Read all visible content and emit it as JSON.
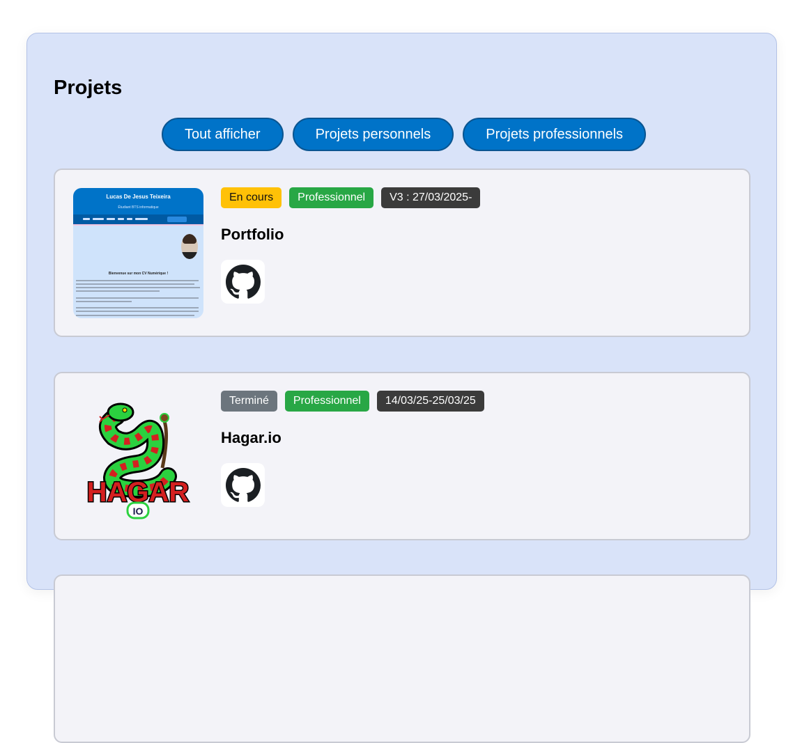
{
  "section": {
    "title": "Projets"
  },
  "filters": [
    {
      "label": "Tout afficher"
    },
    {
      "label": "Projets personnels"
    },
    {
      "label": "Projets professionnels"
    }
  ],
  "projects": [
    {
      "title": "Portfolio",
      "badges": [
        {
          "label": "En cours",
          "color": "#ffc107"
        },
        {
          "label": "Professionnel",
          "color": "#28a745"
        },
        {
          "label": "V3 : 27/03/2025-",
          "color": "#3b3b3b"
        }
      ],
      "thumbnail": {
        "name": "Lucas De Jesus Teixeira",
        "subtitle": "Étudiant BTS informatique",
        "welcome": "Bienvenue sur mon CV Numérique !"
      },
      "link_icon": "github-icon"
    },
    {
      "title": "Hagar.io",
      "badges": [
        {
          "label": "Terminé",
          "color": "#6c757d"
        },
        {
          "label": "Professionnel",
          "color": "#28a745"
        },
        {
          "label": "14/03/25-25/03/25",
          "color": "#3b3b3b"
        }
      ],
      "thumbnail": {
        "logo_text": "HAGAR",
        "logo_sub": "IO"
      },
      "link_icon": "github-icon"
    }
  ],
  "colors": {
    "accent": "#0073c8",
    "panel": "#d9e3f9",
    "card": "#f3f3f8"
  }
}
